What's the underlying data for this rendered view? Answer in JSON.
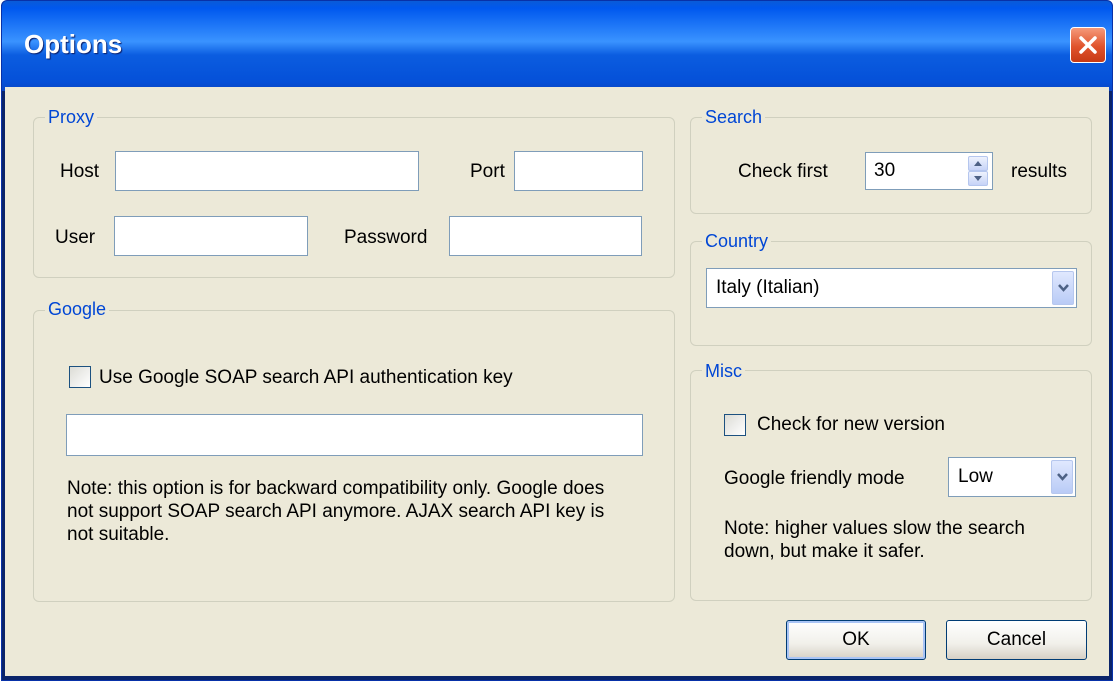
{
  "window": {
    "title": "Options"
  },
  "proxy": {
    "title": "Proxy",
    "host_label": "Host",
    "host_value": "",
    "port_label": "Port",
    "port_value": "",
    "user_label": "User",
    "user_value": "",
    "password_label": "Password",
    "password_value": ""
  },
  "google": {
    "title": "Google",
    "use_key_label": "Use Google SOAP search API authentication key",
    "use_key_checked": false,
    "key_value": "",
    "note": "Note: this option is for backward compatibility only. Google does not support SOAP search API anymore. AJAX search API key is not suitable."
  },
  "search": {
    "title": "Search",
    "check_first_label": "Check first",
    "check_first_value": "30",
    "results_label": "results"
  },
  "country": {
    "title": "Country",
    "selected": "Italy (Italian)"
  },
  "misc": {
    "title": "Misc",
    "check_version_label": "Check for new version",
    "check_version_checked": false,
    "friendly_mode_label": "Google friendly mode",
    "friendly_mode_value": "Low",
    "note": "Note: higher values slow the search down, but make it safer."
  },
  "buttons": {
    "ok": "OK",
    "cancel": "Cancel"
  },
  "colors": {
    "title_bar": "#0058ee",
    "dialog_bg": "#ece9d8",
    "group_title": "#0046d5",
    "close_button": "#e0532c"
  }
}
